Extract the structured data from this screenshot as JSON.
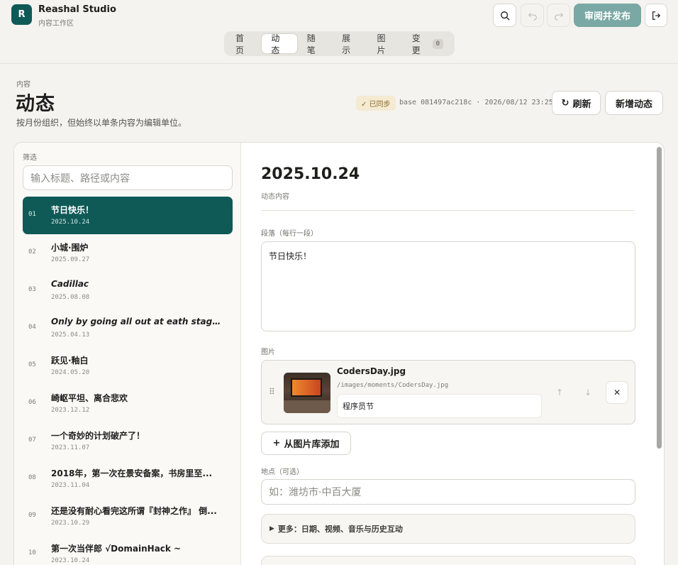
{
  "app": {
    "logo_letter": "R",
    "name": "Reashal Studio",
    "subtitle": "内容工作区"
  },
  "toolbar": {
    "publish_label": "审阅并发布"
  },
  "tabs": [
    {
      "label": "首页"
    },
    {
      "label": "动态",
      "active": true
    },
    {
      "label": "随笔"
    },
    {
      "label": "展示"
    },
    {
      "label": "图片"
    },
    {
      "label": "变更",
      "badge": "0"
    }
  ],
  "header": {
    "eyebrow": "内容",
    "title": "动态",
    "description": "按月份组织，但始终以单条内容为编辑单位。",
    "sync_status": "✓ 已同步",
    "base_info": "base 081497ac218c · 2026/08/12 23:25",
    "refresh_label": "刷新",
    "new_label": "新增动态"
  },
  "sidebar": {
    "filter_label": "筛选",
    "filter_placeholder": "输入标题、路径或内容",
    "items": [
      {
        "num": "01",
        "title": "节日快乐！",
        "date": "2025.10.24",
        "active": true
      },
      {
        "num": "02",
        "title": "小城·围炉",
        "date": "2025.09.27"
      },
      {
        "num": "03",
        "title": "Cadillac",
        "date": "2025.08.08",
        "italic": true
      },
      {
        "num": "04",
        "title": "Only by going all out at eath stage can we ...",
        "date": "2025.04.13",
        "italic": true
      },
      {
        "num": "05",
        "title": "跃见·釉白",
        "date": "2024.05.20"
      },
      {
        "num": "06",
        "title": "崎岖平坦、离合悲欢",
        "date": "2023.12.12"
      },
      {
        "num": "07",
        "title": "一个奇妙的计划破产了！",
        "date": "2023.11.07"
      },
      {
        "num": "08",
        "title": "2018年，第一次在景安备案，书房里至...",
        "date": "2023.11.04"
      },
      {
        "num": "09",
        "title": "还是没有耐心看完这所谓『封神之作』 倒...",
        "date": "2023.10.29"
      },
      {
        "num": "10",
        "title": "第一次当伴郎 √DomainHack ~",
        "date": "2023.10.24"
      }
    ]
  },
  "editor": {
    "title": "2025.10.24",
    "subtitle": "动态内容",
    "paragraph_label": "段落（每行一段）",
    "paragraph_value": "节日快乐！",
    "images_label": "图片",
    "image": {
      "filename": "CodersDay.jpg",
      "path": "/images/moments/CodersDay.jpg",
      "caption": "程序员节"
    },
    "add_from_library_label": "从图片库添加",
    "location_label": "地点（可选）",
    "location_placeholder": "如：潍坊市·中百大厦",
    "more_label": "更多：日期、视频、音乐与历史互动"
  }
}
